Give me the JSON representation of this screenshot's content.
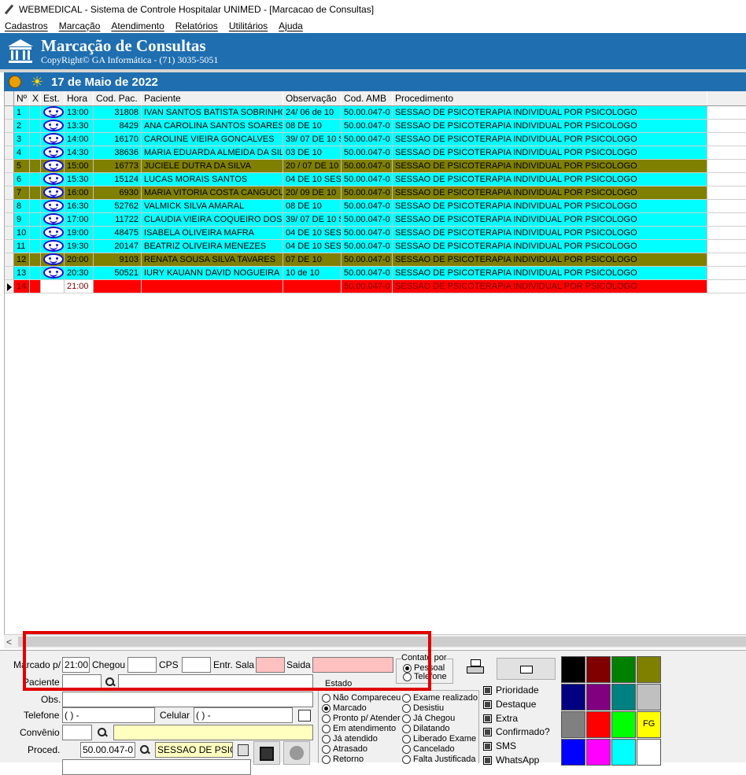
{
  "window": {
    "title": "WEBMEDICAL - Sistema de Controle Hospitalar UNIMED - [Marcacao de Consultas]"
  },
  "menu": [
    "Cadastros",
    "Marcação",
    "Atendimento",
    "Relatórios",
    "Utilitários",
    "Ajuda"
  ],
  "banner": {
    "title": "Marcação de Consultas",
    "subtitle": "CopyRight© GA Informática - (71) 3035-5051"
  },
  "date_label": "17 de Maio de 2022",
  "grid": {
    "columns": [
      "Nº",
      "X",
      "Est.",
      "Hora",
      "Cod. Pac.",
      "Paciente",
      "Observação",
      "Cod. AMB",
      "Procedimento"
    ],
    "rows": [
      {
        "n": "1",
        "hora": "13:00",
        "cod": "31808",
        "paciente": "IVAN SANTOS BATISTA SOBRINHO",
        "obs": "24/ 06 de 10",
        "amb": "50.00.047-0",
        "proc": "SESSAO DE PSICOTERAPIA INDIVIDUAL POR PSICOLOGO",
        "color": "cyan"
      },
      {
        "n": "2",
        "hora": "13:30",
        "cod": "8429",
        "paciente": "ANA CAROLINA SANTOS SOARES",
        "obs": "08 DE 10",
        "amb": "50.00.047-0",
        "proc": "SESSAO DE PSICOTERAPIA INDIVIDUAL POR PSICOLOGO",
        "color": "cyan"
      },
      {
        "n": "3",
        "hora": "14:00",
        "cod": "16170",
        "paciente": "CAROLINE VIEIRA GONCALVES",
        "obs": "39/ 07 DE 10 S",
        "amb": "50.00.047-0",
        "proc": "SESSAO DE PSICOTERAPIA INDIVIDUAL POR PSICOLOGO",
        "color": "cyan"
      },
      {
        "n": "4",
        "hora": "14:30",
        "cod": "38636",
        "paciente": "MARIA EDUARDA ALMEIDA DA SILV",
        "obs": "03 DE 10",
        "amb": "50.00.047-0",
        "proc": "SESSAO DE PSICOTERAPIA INDIVIDUAL POR PSICOLOGO",
        "color": "cyan"
      },
      {
        "n": "5",
        "hora": "15:00",
        "cod": "16773",
        "paciente": "JUCIELE DUTRA DA SILVA",
        "obs": "20 / 07 DE 10",
        "amb": "50.00.047-0",
        "proc": "SESSAO DE PSICOTERAPIA INDIVIDUAL POR PSICOLOGO",
        "color": "olive"
      },
      {
        "n": "6",
        "hora": "15:30",
        "cod": "15124",
        "paciente": "LUCAS MORAIS SANTOS",
        "obs": "04 DE 10 SESS",
        "amb": "50.00.047-0",
        "proc": "SESSAO DE PSICOTERAPIA INDIVIDUAL POR PSICOLOGO",
        "color": "cyan"
      },
      {
        "n": "7",
        "hora": "16:00",
        "cod": "6930",
        "paciente": "MARIA VITORIA COSTA CANGUCU",
        "obs": "20/ 09 DE 10",
        "amb": "50.00.047-0",
        "proc": "SESSAO DE PSICOTERAPIA INDIVIDUAL POR PSICOLOGO",
        "color": "olive"
      },
      {
        "n": "8",
        "hora": "16:30",
        "cod": "52762",
        "paciente": "VALMICK SILVA AMARAL",
        "obs": "08 DE 10",
        "amb": "50.00.047-0",
        "proc": "SESSAO DE PSICOTERAPIA INDIVIDUAL POR PSICOLOGO",
        "color": "cyan"
      },
      {
        "n": "9",
        "hora": "17:00",
        "cod": "11722",
        "paciente": "CLAUDIA VIEIRA COQUEIRO DOS SA",
        "obs": "39/  07 DE 10 S",
        "amb": "50.00.047-0",
        "proc": "SESSAO DE PSICOTERAPIA INDIVIDUAL POR PSICOLOGO",
        "color": "cyan"
      },
      {
        "n": "10",
        "hora": "19:00",
        "cod": "48475",
        "paciente": "ISABELA OLIVEIRA MAFRA",
        "obs": "04 DE 10 SESS",
        "amb": "50.00.047-0",
        "proc": "SESSAO DE PSICOTERAPIA INDIVIDUAL POR PSICOLOGO",
        "color": "cyan"
      },
      {
        "n": "11",
        "hora": "19:30",
        "cod": "20147",
        "paciente": "BEATRIZ OLIVEIRA MENEZES",
        "obs": "04 DE  10 SES",
        "amb": "50.00.047-0",
        "proc": "SESSAO DE PSICOTERAPIA INDIVIDUAL POR PSICOLOGO",
        "color": "cyan"
      },
      {
        "n": "12",
        "hora": "20:00",
        "cod": "9103",
        "paciente": "RENATA SOUSA SILVA TAVARES",
        "obs": "07 DE 10",
        "amb": "50.00.047-0",
        "proc": "SESSAO DE PSICOTERAPIA INDIVIDUAL POR PSICOLOGO",
        "color": "olive"
      },
      {
        "n": "13",
        "hora": "20:30",
        "cod": "50521",
        "paciente": "IURY KAUANN DAVID NOGUEIRA",
        "obs": "10 de 10",
        "amb": "50.00.047-0",
        "proc": "SESSAO DE PSICOTERAPIA INDIVIDUAL POR PSICOLOGO",
        "color": "cyan"
      },
      {
        "n": "14",
        "hora": "21:00",
        "cod": "",
        "paciente": "",
        "obs": "",
        "amb": "50.00.047-0",
        "proc": "SESSAO DE PSICOTERAPIA INDIVIDUAL POR PSICOLOGO",
        "color": "red"
      }
    ]
  },
  "form": {
    "marcado_label": "Marcado p/",
    "marcado_value": "21:00",
    "chegou_label": "Chegou",
    "cps_label": "CPS",
    "entr_label": "Entr. Sala",
    "saida_label": "Saida",
    "paciente_label": "Paciente",
    "obs_label": "Obs.",
    "telefone_label": "Telefone",
    "telefone_value": "(  )       -",
    "celular_label": "Celular",
    "celular_value": "(  )       -",
    "convenio_label": "Convênio",
    "proced_label": "Proced.",
    "proced_code": "50.00.047-0",
    "proced_name": "SESSAO DE PSIC"
  },
  "contato": {
    "label": "Contato por",
    "options": [
      "Pessoal",
      "Telefone"
    ],
    "selected": "Pessoal"
  },
  "estado": {
    "label": "Estado",
    "col1": [
      "Não Compareceu",
      "Marcado",
      "Pronto p/ Atender",
      "Em atendimento",
      "Já atendido",
      "Atrasado",
      "Retorno"
    ],
    "col2": [
      "Exame realizado",
      "Desistiu",
      "Já Chegou",
      "Dilatando",
      "Liberado Exame",
      "Cancelado",
      "Falta Justificada"
    ],
    "selected": "Marcado"
  },
  "flags": [
    "Prioridade",
    "Destaque",
    "Extra",
    "Confirmado?",
    "SMS",
    "WhatsApp"
  ],
  "palette": {
    "colors": [
      "#000000",
      "#800000",
      "#008000",
      "#808000",
      "#000080",
      "#800080",
      "#008080",
      "#c0c0c0",
      "#808080",
      "#ff0000",
      "#00ff00",
      "#ffff00",
      "#0000ff",
      "#ff00ff",
      "#00ffff",
      "#ffffff"
    ],
    "fg_label": "FG"
  }
}
